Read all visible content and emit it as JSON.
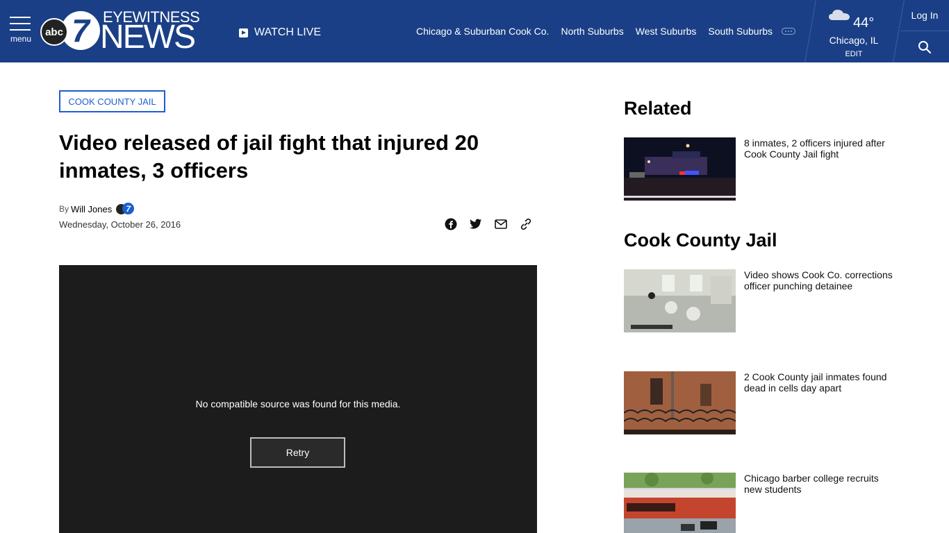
{
  "header": {
    "menu_label": "menu",
    "logo": {
      "abc": "abc",
      "seven": "7",
      "eyewitness": "EYEWITNESS",
      "news": "NEWS"
    },
    "watch_live": "WATCH LIVE",
    "nav": [
      "Chicago & Suburban Cook Co.",
      "North Suburbs",
      "West Suburbs",
      "South Suburbs"
    ],
    "weather": {
      "temp": "44°",
      "city": "Chicago, IL",
      "edit": "EDIT",
      "icon": "cloud-icon"
    },
    "login": "Log In"
  },
  "article": {
    "tag": "COOK COUNTY JAIL",
    "headline": "Video released of jail fight that injured 20 inmates, 3 officers",
    "by": "By",
    "author": "Will Jones",
    "date": "Wednesday, October 26, 2016",
    "share_icons": [
      "facebook-icon",
      "twitter-icon",
      "email-icon",
      "link-icon"
    ],
    "video": {
      "message": "No compatible source was found for this media.",
      "retry": "Retry"
    }
  },
  "sidebar": {
    "related_heading": "Related",
    "related": [
      {
        "title": "8 inmates, 2 officers injured after Cook County Jail fight"
      }
    ],
    "section_heading": "Cook County Jail",
    "section": [
      {
        "title": "Video shows Cook Co. corrections officer punching detainee"
      },
      {
        "title": "2 Cook County jail inmates found dead in cells day apart"
      },
      {
        "title": "Chicago barber college recruits new students"
      }
    ]
  },
  "colors": {
    "header_bg": "#1a3f86",
    "tag_accent": "#1c5ed2",
    "video_bg": "#1c1c1c"
  }
}
